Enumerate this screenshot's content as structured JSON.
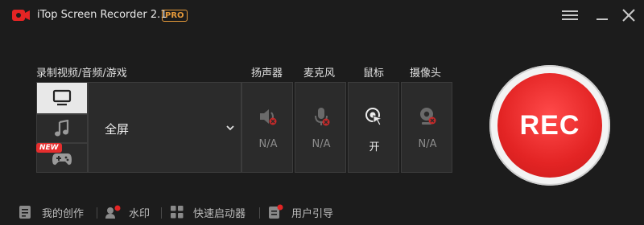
{
  "app": {
    "title": "iTop Screen Recorder 2.1",
    "badge": "PRO"
  },
  "labels": {
    "mode": "录制视频/音频/游戏",
    "speaker": "扬声器",
    "mic": "麦克风",
    "mouse": "鼠标",
    "camera": "摄像头"
  },
  "modes": [
    {
      "name": "screen",
      "active": true
    },
    {
      "name": "audio",
      "active": false
    },
    {
      "name": "game",
      "active": false,
      "badge": "NEW"
    }
  ],
  "area": {
    "selected": "全屏"
  },
  "devices": {
    "speaker": {
      "status": "N/A"
    },
    "mic": {
      "status": "N/A"
    },
    "mouse": {
      "status": "开"
    },
    "camera": {
      "status": "N/A"
    }
  },
  "rec": {
    "label": "REC"
  },
  "footer": {
    "my_creations": "我的创作",
    "watermark": "水印",
    "quick_launcher": "快速启动器",
    "user_guide": "用户引导"
  },
  "colors": {
    "accent": "#e32424",
    "background": "#1c1c1c",
    "panel": "#2b2b2b",
    "pro_badge": "#e69a3a"
  }
}
